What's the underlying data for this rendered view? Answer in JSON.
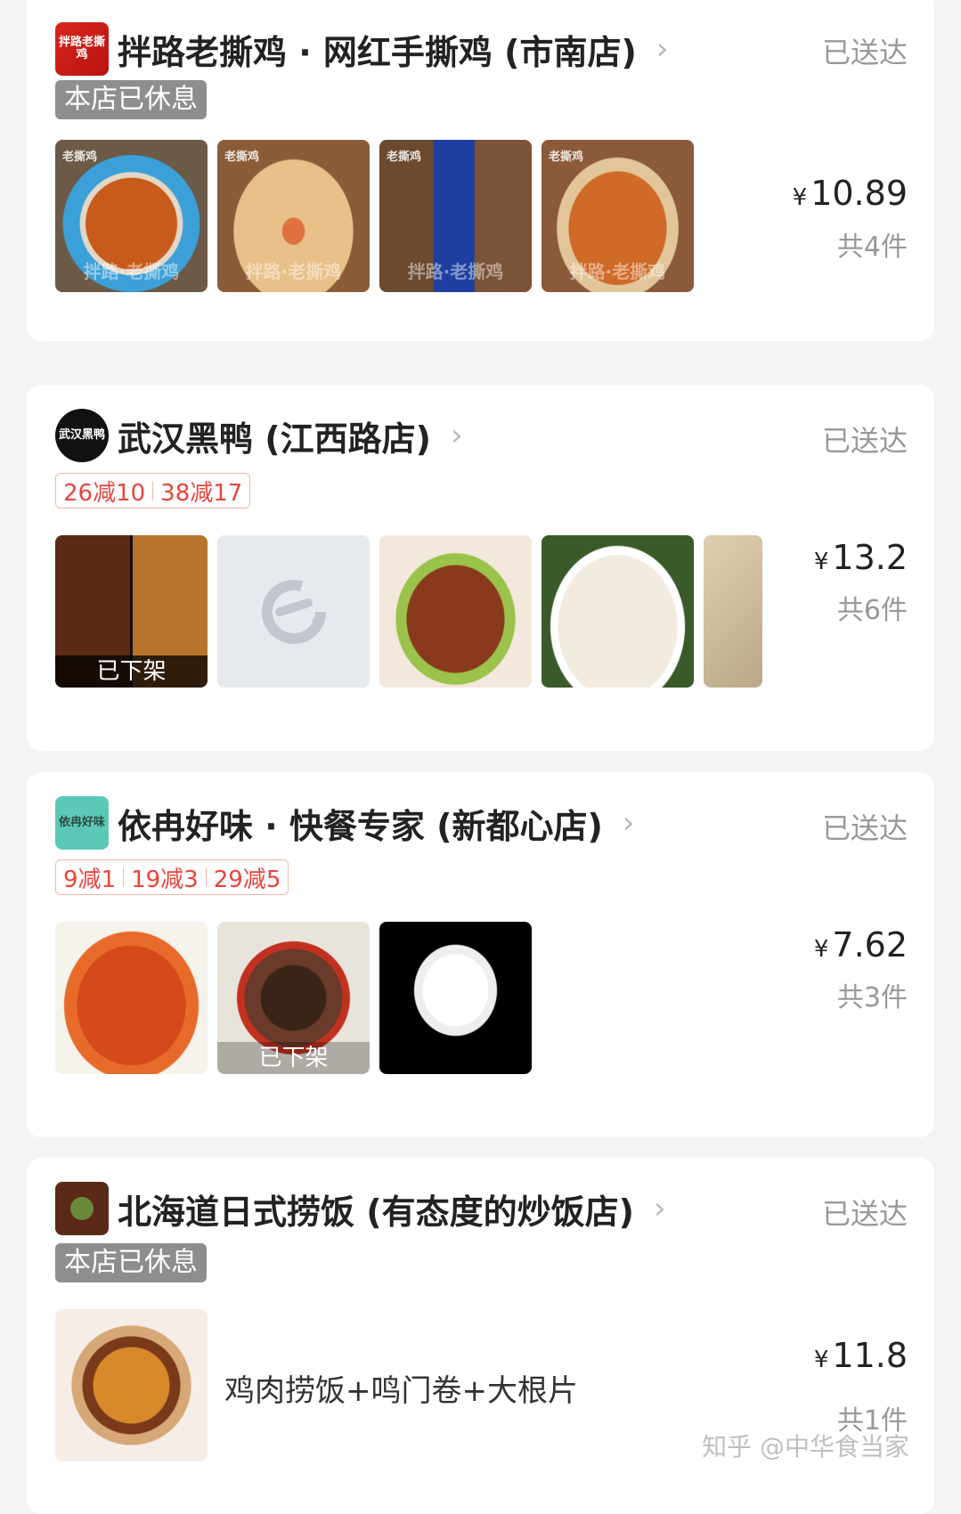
{
  "orders": [
    {
      "store": "拌路老撕鸡 · 网红手撕鸡 (市南店)",
      "logo_text": "拌路老撕鸡",
      "status": "已送达",
      "tag": "本店已休息",
      "items": [
        {
          "label": "老撕鸡",
          "watermark": "拌路·老撕鸡"
        },
        {
          "label": "老撕鸡",
          "watermark": "拌路·老撕鸡"
        },
        {
          "label": "老撕鸡",
          "watermark": "拌路·老撕鸡"
        },
        {
          "label": "老撕鸡",
          "watermark": "拌路·老撕鸡"
        }
      ],
      "currency": "¥",
      "price": "10.89",
      "count": "共4件"
    },
    {
      "store": "武汉黑鸭 (江西路店)",
      "logo_text": "武汉黑鸭",
      "status": "已送达",
      "promotions": [
        "26减10",
        "38减17"
      ],
      "items": [
        {
          "overlay": "已下架"
        },
        {
          "placeholder_icon": "e-logo-icon"
        },
        {},
        {},
        {}
      ],
      "currency": "¥",
      "price": "13.2",
      "count": "共6件"
    },
    {
      "store": "依冉好味 · 快餐专家 (新都心店)",
      "logo_text": "依冉好味",
      "status": "已送达",
      "promotions": [
        "9减1",
        "19减3",
        "29减5"
      ],
      "items": [
        {},
        {
          "overlay": "已下架"
        },
        {}
      ],
      "currency": "¥",
      "price": "7.62",
      "count": "共3件"
    },
    {
      "store": "北海道日式捞饭 (有态度的炒饭店)",
      "status": "已送达",
      "tag": "本店已休息",
      "item_desc": "鸡肉捞饭+鸣门卷+大根片",
      "currency": "¥",
      "price": "11.8",
      "count": "共1件"
    }
  ],
  "watermark": "知乎 @中华食当家",
  "colors": {
    "promo_red": "#e8453c",
    "status_gray": "#999999",
    "closed_tag": "#8e8e8e"
  }
}
